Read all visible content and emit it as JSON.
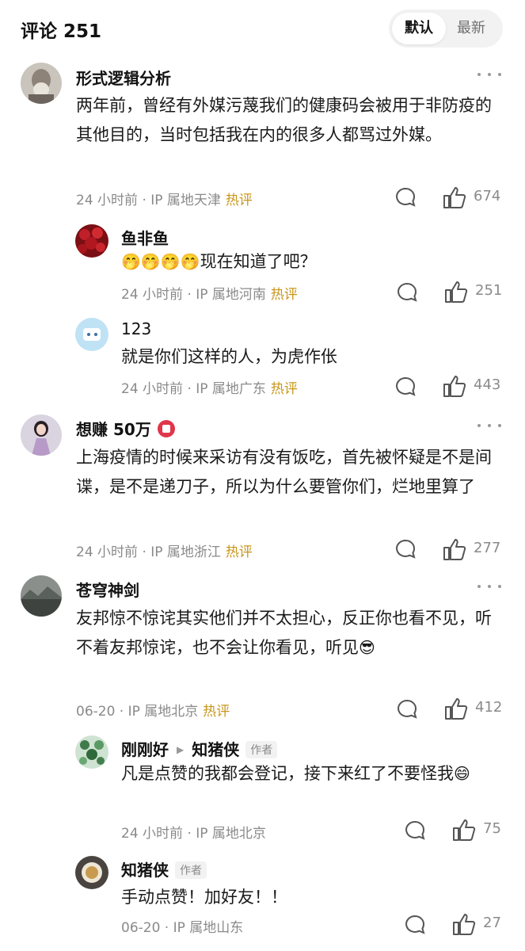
{
  "header": {
    "title": "评论 251",
    "sort_default": "默认",
    "sort_latest": "最新"
  },
  "comments": [
    {
      "name": "形式逻辑分析",
      "text": "两年前，曾经有外媒污蔑我们的健康码会被用于非防疫的其他目的，当时包括我在内的很多人都骂过外媒。",
      "time": "24 小时前 · IP 属地天津",
      "hot": "热评",
      "likes": "674",
      "avatar": "old-man-avatar",
      "replies": [
        {
          "name": "鱼非鱼",
          "emoji": "🤭🤭🤭🤭",
          "text": "现在知道了吧？",
          "time": "24 小时前 · IP 属地河南",
          "hot": "热评",
          "likes": "251",
          "avatar": "red-flowers-avatar"
        },
        {
          "name": "123",
          "text": "就是你们这样的人，为虎作伥",
          "time": "24 小时前 · IP 属地广东",
          "hot": "热评",
          "likes": "443",
          "avatar": "cartoon-avatar"
        }
      ]
    },
    {
      "name": "想赚 50万",
      "text": "上海疫情的时候来采访有没有饭吃，首先被怀疑是不是间谍，是不是递刀子，所以为什么要管你们，烂地里算了",
      "time": "24 小时前 · IP 属地浙江",
      "hot": "热评",
      "likes": "277",
      "avatar": "woman-avatar"
    },
    {
      "name": "苍穹神剑",
      "text": "友邦惊不惊诧其实他们并不太担心，反正你也看不见，听不着友邦惊诧，也不会让你看见，听见",
      "emoji_suffix": "😎",
      "time": "06-20 · IP 属地北京",
      "hot": "热评",
      "likes": "412",
      "avatar": "landscape-avatar",
      "replies": [
        {
          "name": "刚刚好",
          "reply_to": "知猪侠",
          "reply_to_tag": "作者",
          "text": "凡是点赞的我都会登记，接下来红了不要怪我",
          "emoji_suffix": "😄",
          "time": "24 小时前 · IP 属地北京",
          "likes": "75",
          "avatar": "green-pattern-avatar"
        },
        {
          "name": "知猪侠",
          "author_tag": "作者",
          "text": "手动点赞！加好友！！",
          "time": "06-20 · IP 属地山东",
          "likes": "27",
          "avatar": "bowl-avatar"
        }
      ]
    }
  ],
  "colors": {
    "hot_label": "#c8961a",
    "meta_text": "#8a8a8a",
    "badge": "#e0364a"
  }
}
